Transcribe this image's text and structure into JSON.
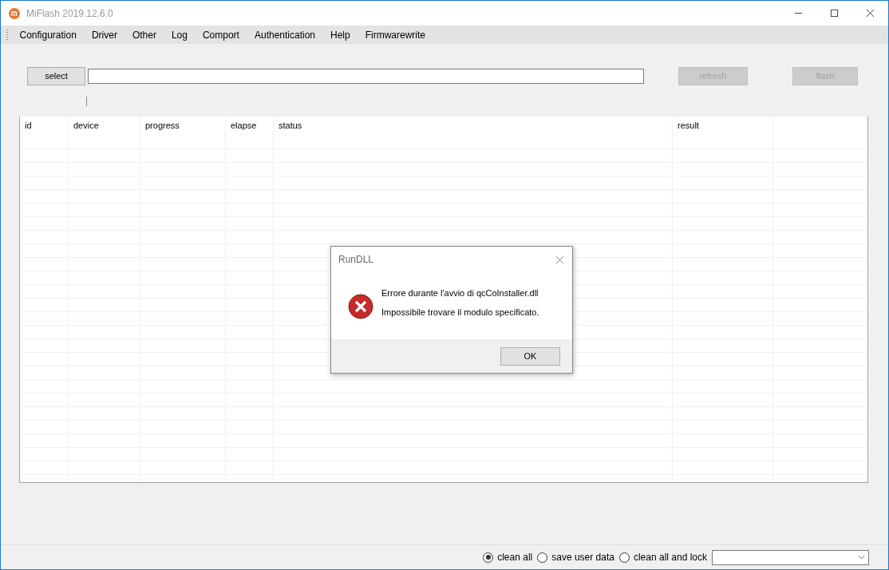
{
  "window": {
    "title": "MiFlash 2019.12.6.0"
  },
  "menu": [
    "Configuration",
    "Driver",
    "Other",
    "Log",
    "Comport",
    "Authentication",
    "Help",
    "Firmwarewrite"
  ],
  "toolbar": {
    "select_button": {
      "label": "select",
      "disabled": false
    },
    "refresh_button": {
      "label": "refresh",
      "disabled": true
    },
    "flash_button": {
      "label": "flash",
      "disabled": true
    }
  },
  "table": {
    "columns": [
      "id",
      "device",
      "progress",
      "elapse",
      "status",
      "result"
    ]
  },
  "dialog": {
    "title": "RunDLL",
    "message": "Errore durante l'avvio di qcCoInstaller.dll",
    "detail": "Impossibile trovare il modulo specificato.",
    "button": "OK"
  },
  "options": [
    {
      "label": "clean all",
      "selected": true
    },
    {
      "label": "save user data",
      "selected": false
    },
    {
      "label": "clean all and lock",
      "selected": false
    }
  ]
}
